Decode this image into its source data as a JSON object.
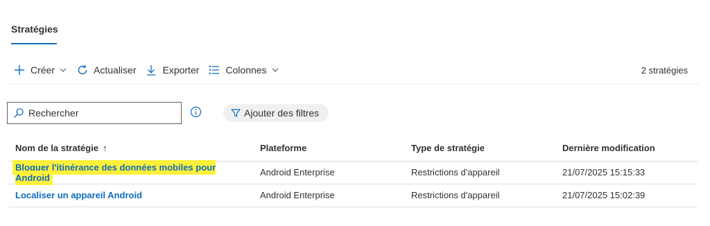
{
  "tab": {
    "label": "Stratégies"
  },
  "toolbar": {
    "create": "Créer",
    "refresh": "Actualiser",
    "export": "Exporter",
    "columns": "Colonnes",
    "count": "2 stratégies"
  },
  "search": {
    "placeholder": "Rechercher"
  },
  "filters": {
    "label": "Ajouter des filtres"
  },
  "table": {
    "headers": {
      "name": "Nom de la stratégie",
      "platform": "Plateforme",
      "type": "Type de stratégie",
      "modified": "Dernière modification"
    },
    "sort_icon": "↑",
    "rows": [
      {
        "name": "Bloquer l'itinérance des données mobiles pour Android",
        "platform": "Android Enterprise",
        "type": "Restrictions d'appareil",
        "modified": "21/07/2025 15:15:33",
        "highlighted": true
      },
      {
        "name": "Localiser un appareil Android",
        "platform": "Android Enterprise",
        "type": "Restrictions d'appareil",
        "modified": "21/07/2025 15:02:39",
        "highlighted": false
      }
    ]
  },
  "colors": {
    "accent": "#0f6cbd",
    "highlight": "#fff13b"
  },
  "icons": {
    "create": "plus-icon",
    "refresh": "refresh-icon",
    "export": "download-icon",
    "columns": "columns-list-icon",
    "search": "search-icon",
    "info": "info-icon",
    "filter": "filter-icon"
  }
}
